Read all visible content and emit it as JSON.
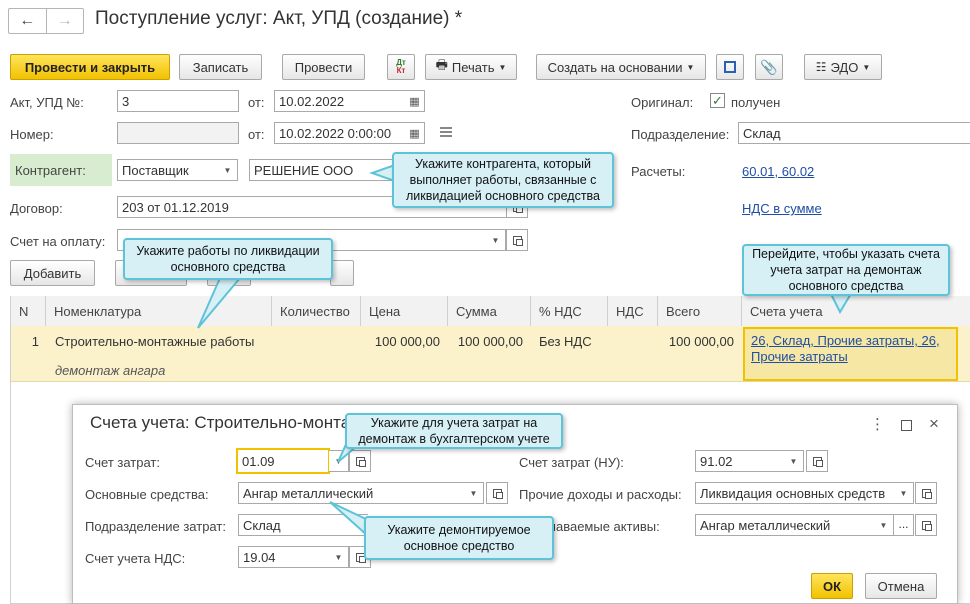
{
  "window": {
    "title": "Поступление услуг: Акт, УПД (создание) *"
  },
  "toolbar": {
    "post_close": "Провести и закрыть",
    "save": "Записать",
    "post": "Провести",
    "dtkt_top": "Дт",
    "dtkt_bottom": "Кт",
    "print": "Печать",
    "create_based": "Создать на основании",
    "edo": "ЭДО"
  },
  "form": {
    "act_label": "Акт, УПД №:",
    "act_value": "3",
    "from_label": "от:",
    "date1": "10.02.2022",
    "number_label": "Номер:",
    "number_value": "",
    "date2": "10.02.2022  0:00:00",
    "original_label": "Оригинал:",
    "original_value": "получен",
    "division_label": "Подразделение:",
    "division_value": "Склад",
    "counterparty_label": "Контрагент:",
    "counterparty_type": "Поставщик",
    "counterparty_value": "РЕШЕНИЕ ООО",
    "settlements_label": "Расчеты:",
    "settlements_value": "60.01, 60.02",
    "contract_label": "Договор:",
    "contract_value": "203 от 01.12.2019",
    "vat_link": "НДС в сумме",
    "invoice_label": "Счет на оплату:",
    "invoice_value": "",
    "add_button": "Добавить"
  },
  "table": {
    "headers": [
      "N",
      "Номенклатура",
      "Количество",
      "Цена",
      "Сумма",
      "% НДС",
      "НДС",
      "Всего",
      "Счета учета"
    ],
    "row": {
      "n": "1",
      "name": "Строительно-монтажные работы",
      "subname": "демонтаж ангара",
      "qty": "",
      "price": "100 000,00",
      "sum": "100 000,00",
      "vat_rate": "Без НДС",
      "vat": "",
      "total": "100 000,00",
      "accounts": "26, Склад, Прочие затраты, 26, Прочие затраты"
    }
  },
  "dialog": {
    "title": "Счета учета: Строительно-монтажные работы",
    "cost_account_label": "Счет затрат:",
    "cost_account_value": "01.09",
    "cost_account_tax_label": "Счет затрат (НУ):",
    "cost_account_tax_value": "91.02",
    "fixed_assets_label": "Основные средства:",
    "fixed_assets_value": "Ангар металлический",
    "other_income_label": "Прочие доходы и расходы:",
    "other_income_value": "Ликвидация основных средств",
    "cost_division_label": "Подразделение затрат:",
    "cost_division_value": "Склад",
    "assets_label": "Признаваемые активы:",
    "assets_value": "Ангар металлический",
    "vat_account_label": "Счет учета НДС:",
    "vat_account_value": "19.04",
    "ok": "ОК",
    "cancel": "Отмена"
  },
  "tips": {
    "counterparty": "Укажите контрагента, который выполняет работы, связанные с ликвидацией основного средства",
    "works": "Укажите работы по ликвидации основного средства",
    "accounts": "Перейдите, чтобы указать счета учета затрат на демонтаж основного средства",
    "cost": "Укажите для учета затрат на демонтаж в бухгалтерском учете",
    "asset": "Укажите демонтируемое основное средство"
  },
  "colors": {
    "accent": "#f2c200",
    "tip_bg": "#d6f0f6",
    "tip_border": "#5ec3d8",
    "link": "#1f4ea6"
  }
}
